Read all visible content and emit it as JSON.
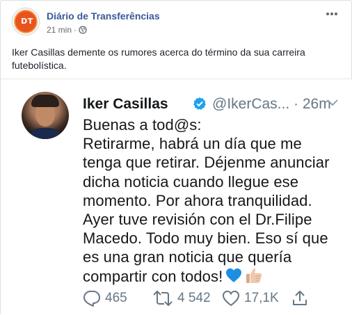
{
  "post": {
    "page_name": "Diário de Transferências",
    "avatar_initials": "DT",
    "time": "21 min",
    "separator": "·",
    "text": "Iker Casillas demente os rumores acerca do término da sua carreira futebolística."
  },
  "tweet": {
    "name": "Iker Casillas",
    "handle": "@IkerCas... · 26m",
    "lines": [
      "Buenas a tod@s:",
      "Retirarme, habrá un día que me",
      "tenga que retirar. Déjenme anunciar",
      "dicha noticia cuando llegue ese",
      "momento. Por ahora tranquilidad.",
      "Ayer tuve revisión con el Dr.Filipe",
      "Macedo. Todo muy bien. Eso sí que",
      "es una gran noticia que quería",
      "compartir con todos!"
    ],
    "emojis": [
      "blue-heart",
      "thumbs-up"
    ],
    "replies": "465",
    "retweets": "4 542",
    "likes": "17,1K"
  },
  "icons": {
    "header_more": "ellipsis-icon",
    "privacy": "globe-icon",
    "verified": "verified-badge-icon",
    "caret": "chevron-down-icon",
    "reply": "reply-icon",
    "retweet": "retweet-icon",
    "like": "heart-icon",
    "share": "share-icon"
  },
  "colors": {
    "fb_link": "#385898",
    "meta_gray": "#616770",
    "twitter_text": "#14171a",
    "twitter_gray": "#657786",
    "verified_blue": "#1da1f2",
    "avatar_orange": "#e8541e"
  }
}
